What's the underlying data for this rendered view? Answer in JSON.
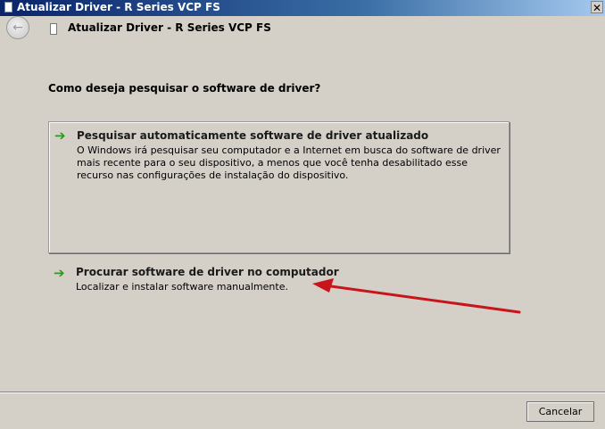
{
  "window": {
    "title": "Atualizar Driver -  R Series VCP FS",
    "close_label": "✕"
  },
  "nav": {
    "back_icon": "←",
    "title": "Atualizar Driver -  R Series VCP FS"
  },
  "question": "Como deseja pesquisar o software de driver?",
  "options": [
    {
      "arrow": "➔",
      "title": "Pesquisar automaticamente software de driver atualizado",
      "description": "O Windows irá pesquisar seu computador e a Internet em busca do software de driver mais recente para o seu dispositivo, a menos que você tenha desabilitado esse recurso nas configurações de instalação do dispositivo."
    },
    {
      "arrow": "➔",
      "title": "Procurar software de driver no computador",
      "description": "Localizar e instalar software manualmente."
    }
  ],
  "footer": {
    "cancel_label": "Cancelar"
  },
  "colors": {
    "option_arrow": "#2c9a1e",
    "annotation_arrow": "#c8151b"
  }
}
